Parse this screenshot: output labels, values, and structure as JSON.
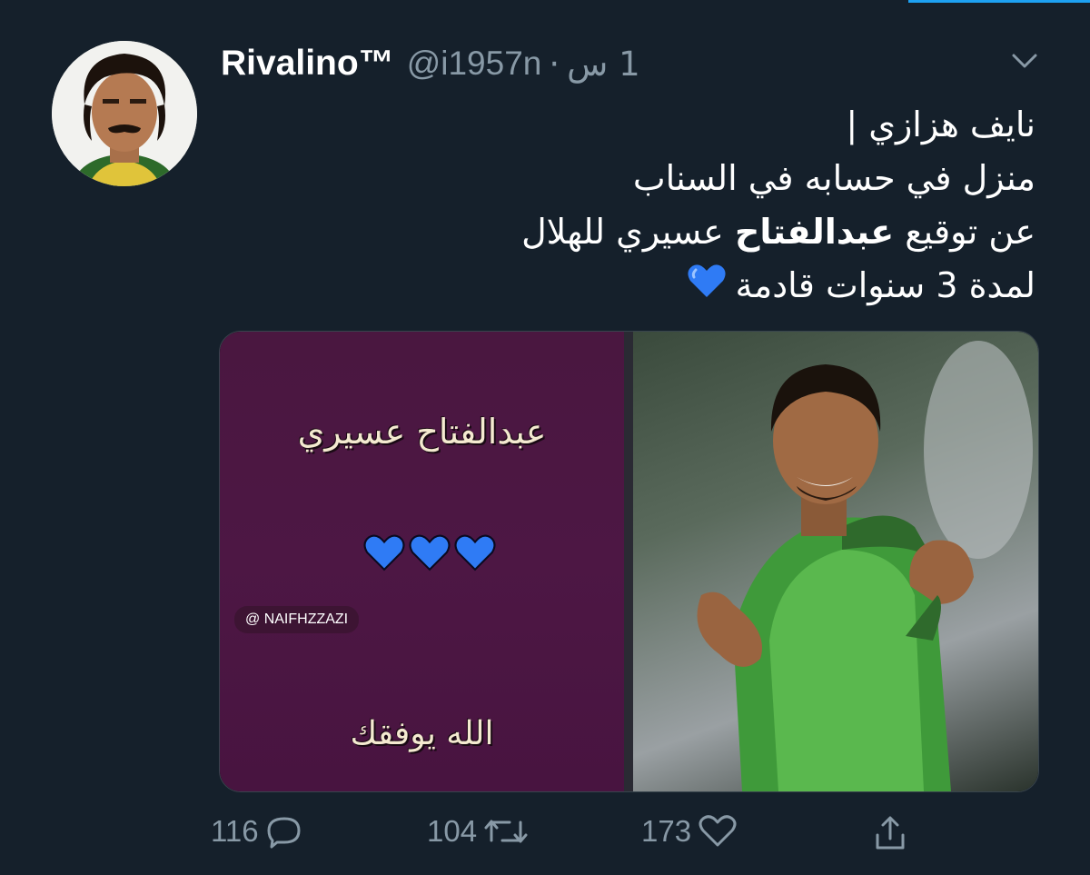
{
  "tweet": {
    "author_name": "Rivalino™",
    "handle": "@i1957n",
    "separator": "·",
    "time": "1 س",
    "text_lines": [
      "نايف هزازي |",
      "منزل في حسابه في السناب",
      "عن توقيع عبدالفتاح عسيري للهلال",
      "لمدة 3 سنوات قادمة"
    ],
    "text_line3_prefix": "عن توقيع ",
    "text_line3_bold": "عبدالفتاح",
    "text_line3_suffix": " عسيري للهلال",
    "emoji": "blue-heart-icon"
  },
  "media": {
    "image_name_text": "عبدالفتاح  عسيري",
    "image_tag": "@ NAIFHZZAZI",
    "image_bless_text": "الله  يوفقك"
  },
  "actions": {
    "replies": "116",
    "retweets": "104",
    "likes": "173"
  },
  "colors": {
    "background": "#15202b",
    "secondary_text": "#8899a6",
    "accent": "#1da1f2",
    "heart_blue": "#2f7bf5"
  }
}
